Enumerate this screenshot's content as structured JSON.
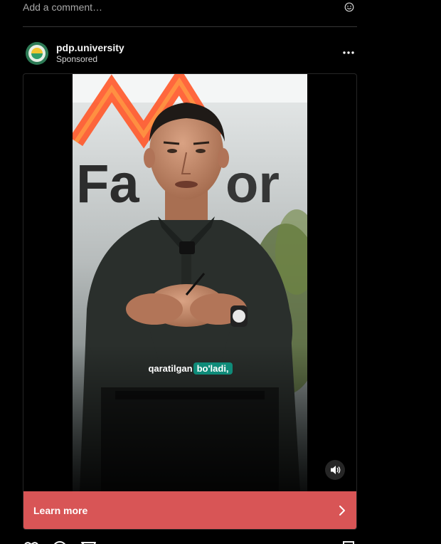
{
  "comment_box": {
    "placeholder": "Add a comment…",
    "emoji_icon": "smiley-icon"
  },
  "post": {
    "username": "pdp.university",
    "sponsored_label": "Sponsored",
    "more_icon": "ellipsis-icon",
    "avatar_icon": "pdp-logo"
  },
  "video": {
    "caption_words": [
      "qaratilgan",
      "bo'ladi,"
    ],
    "audio_icon": "speaker-icon",
    "background_sign_text": "Fa...or"
  },
  "cta": {
    "label": "Learn more",
    "icon": "chevron-right-icon",
    "color": "#d85556"
  },
  "actions": {
    "icons": [
      "heart-icon",
      "comment-icon",
      "share-icon",
      "bookmark-icon"
    ]
  },
  "colors": {
    "background": "#000000",
    "divider": "#363636",
    "caption_highlight": "#0f8b79"
  }
}
